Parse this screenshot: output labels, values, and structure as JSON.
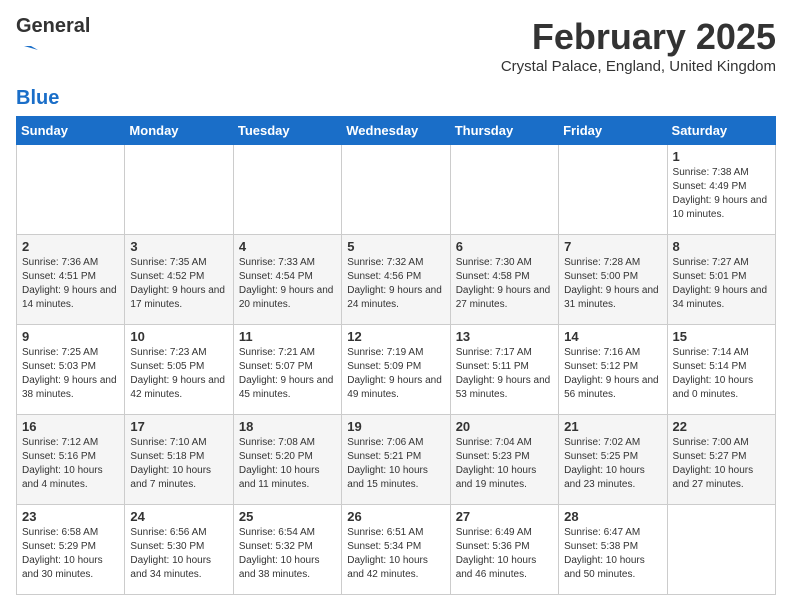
{
  "logo": {
    "general": "General",
    "blue": "Blue"
  },
  "title": "February 2025",
  "location": "Crystal Palace, England, United Kingdom",
  "weekdays": [
    "Sunday",
    "Monday",
    "Tuesday",
    "Wednesday",
    "Thursday",
    "Friday",
    "Saturday"
  ],
  "weeks": [
    [
      {
        "day": "",
        "info": ""
      },
      {
        "day": "",
        "info": ""
      },
      {
        "day": "",
        "info": ""
      },
      {
        "day": "",
        "info": ""
      },
      {
        "day": "",
        "info": ""
      },
      {
        "day": "",
        "info": ""
      },
      {
        "day": "1",
        "info": "Sunrise: 7:38 AM\nSunset: 4:49 PM\nDaylight: 9 hours and 10 minutes."
      }
    ],
    [
      {
        "day": "2",
        "info": "Sunrise: 7:36 AM\nSunset: 4:51 PM\nDaylight: 9 hours and 14 minutes."
      },
      {
        "day": "3",
        "info": "Sunrise: 7:35 AM\nSunset: 4:52 PM\nDaylight: 9 hours and 17 minutes."
      },
      {
        "day": "4",
        "info": "Sunrise: 7:33 AM\nSunset: 4:54 PM\nDaylight: 9 hours and 20 minutes."
      },
      {
        "day": "5",
        "info": "Sunrise: 7:32 AM\nSunset: 4:56 PM\nDaylight: 9 hours and 24 minutes."
      },
      {
        "day": "6",
        "info": "Sunrise: 7:30 AM\nSunset: 4:58 PM\nDaylight: 9 hours and 27 minutes."
      },
      {
        "day": "7",
        "info": "Sunrise: 7:28 AM\nSunset: 5:00 PM\nDaylight: 9 hours and 31 minutes."
      },
      {
        "day": "8",
        "info": "Sunrise: 7:27 AM\nSunset: 5:01 PM\nDaylight: 9 hours and 34 minutes."
      }
    ],
    [
      {
        "day": "9",
        "info": "Sunrise: 7:25 AM\nSunset: 5:03 PM\nDaylight: 9 hours and 38 minutes."
      },
      {
        "day": "10",
        "info": "Sunrise: 7:23 AM\nSunset: 5:05 PM\nDaylight: 9 hours and 42 minutes."
      },
      {
        "day": "11",
        "info": "Sunrise: 7:21 AM\nSunset: 5:07 PM\nDaylight: 9 hours and 45 minutes."
      },
      {
        "day": "12",
        "info": "Sunrise: 7:19 AM\nSunset: 5:09 PM\nDaylight: 9 hours and 49 minutes."
      },
      {
        "day": "13",
        "info": "Sunrise: 7:17 AM\nSunset: 5:11 PM\nDaylight: 9 hours and 53 minutes."
      },
      {
        "day": "14",
        "info": "Sunrise: 7:16 AM\nSunset: 5:12 PM\nDaylight: 9 hours and 56 minutes."
      },
      {
        "day": "15",
        "info": "Sunrise: 7:14 AM\nSunset: 5:14 PM\nDaylight: 10 hours and 0 minutes."
      }
    ],
    [
      {
        "day": "16",
        "info": "Sunrise: 7:12 AM\nSunset: 5:16 PM\nDaylight: 10 hours and 4 minutes."
      },
      {
        "day": "17",
        "info": "Sunrise: 7:10 AM\nSunset: 5:18 PM\nDaylight: 10 hours and 7 minutes."
      },
      {
        "day": "18",
        "info": "Sunrise: 7:08 AM\nSunset: 5:20 PM\nDaylight: 10 hours and 11 minutes."
      },
      {
        "day": "19",
        "info": "Sunrise: 7:06 AM\nSunset: 5:21 PM\nDaylight: 10 hours and 15 minutes."
      },
      {
        "day": "20",
        "info": "Sunrise: 7:04 AM\nSunset: 5:23 PM\nDaylight: 10 hours and 19 minutes."
      },
      {
        "day": "21",
        "info": "Sunrise: 7:02 AM\nSunset: 5:25 PM\nDaylight: 10 hours and 23 minutes."
      },
      {
        "day": "22",
        "info": "Sunrise: 7:00 AM\nSunset: 5:27 PM\nDaylight: 10 hours and 27 minutes."
      }
    ],
    [
      {
        "day": "23",
        "info": "Sunrise: 6:58 AM\nSunset: 5:29 PM\nDaylight: 10 hours and 30 minutes."
      },
      {
        "day": "24",
        "info": "Sunrise: 6:56 AM\nSunset: 5:30 PM\nDaylight: 10 hours and 34 minutes."
      },
      {
        "day": "25",
        "info": "Sunrise: 6:54 AM\nSunset: 5:32 PM\nDaylight: 10 hours and 38 minutes."
      },
      {
        "day": "26",
        "info": "Sunrise: 6:51 AM\nSunset: 5:34 PM\nDaylight: 10 hours and 42 minutes."
      },
      {
        "day": "27",
        "info": "Sunrise: 6:49 AM\nSunset: 5:36 PM\nDaylight: 10 hours and 46 minutes."
      },
      {
        "day": "28",
        "info": "Sunrise: 6:47 AM\nSunset: 5:38 PM\nDaylight: 10 hours and 50 minutes."
      },
      {
        "day": "",
        "info": ""
      }
    ]
  ]
}
